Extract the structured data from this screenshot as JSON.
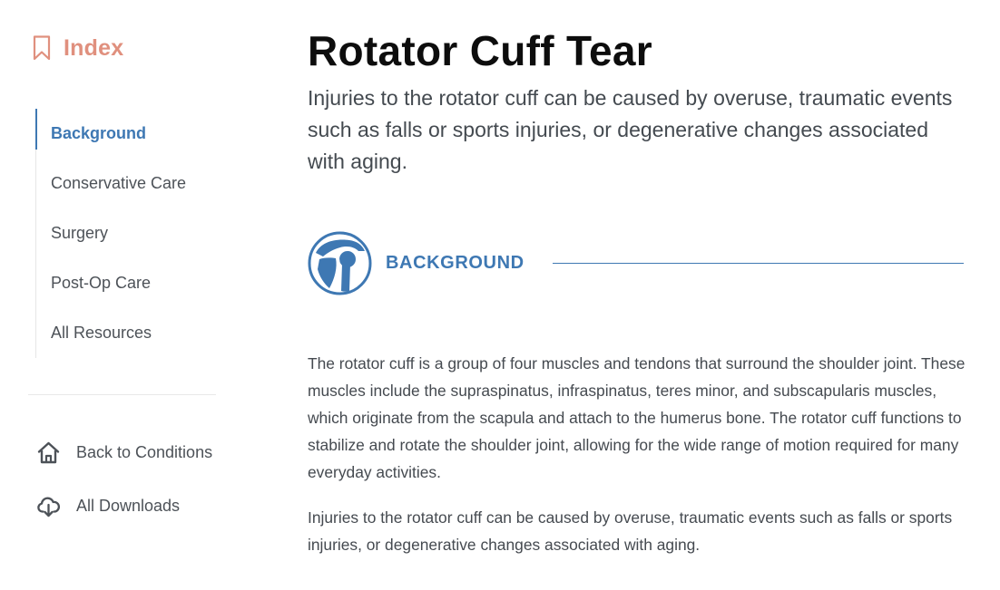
{
  "sidebar": {
    "index_title": "Index",
    "items": [
      {
        "label": "Background",
        "active": true
      },
      {
        "label": "Conservative Care",
        "active": false
      },
      {
        "label": "Surgery",
        "active": false
      },
      {
        "label": "Post-Op Care",
        "active": false
      },
      {
        "label": "All Resources",
        "active": false
      }
    ],
    "back_link": {
      "label": "Back to Conditions",
      "icon": "home-icon"
    },
    "downloads_link": {
      "label": "All Downloads",
      "icon": "cloud-download-icon"
    }
  },
  "main": {
    "title": "Rotator Cuff Tear",
    "subtitle": "Injuries to the rotator cuff can be caused by overuse, traumatic events such as falls or sports injuries, or degenerative changes associated with aging.",
    "section": {
      "title": "BACKGROUND",
      "icon": "shoulder-joint-icon"
    },
    "paragraphs": [
      "The rotator cuff is a group of four muscles and tendons that surround the shoulder joint. These muscles include the supraspinatus, infraspinatus, teres minor, and subscapularis muscles, which originate from the scapula and attach to the humerus bone. The rotator cuff functions to stabilize and rotate the shoulder joint, allowing for the wide range of motion required for many everyday activities.",
      "Injuries to the rotator cuff can be caused by overuse, traumatic events such as falls or sports injuries, or degenerative changes associated with aging."
    ]
  },
  "colors": {
    "accent_blue": "#3e78b3",
    "index_salmon": "#e0907e",
    "title_black": "#0d0d0d",
    "body_text": "#454a50"
  }
}
